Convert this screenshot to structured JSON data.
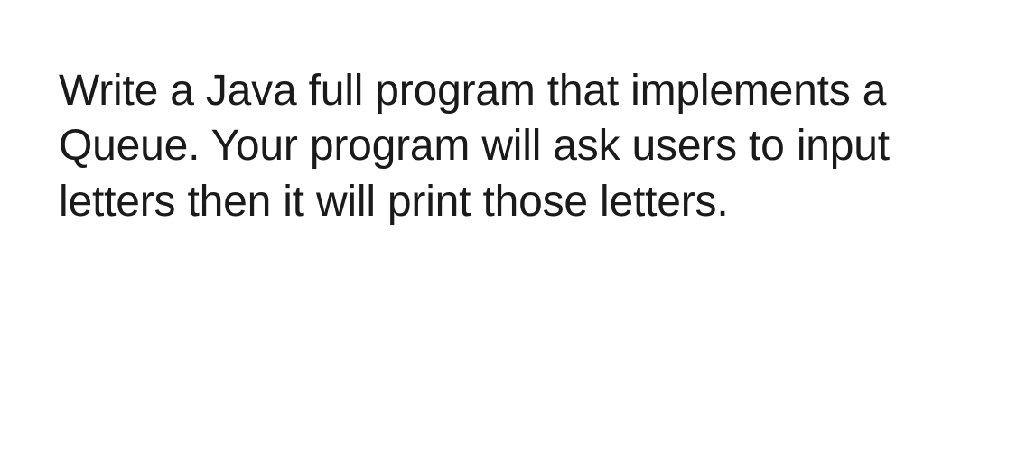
{
  "document": {
    "paragraph": "Write a Java full program that implements a Queue. Your program will ask users to input letters then it will print those letters."
  }
}
